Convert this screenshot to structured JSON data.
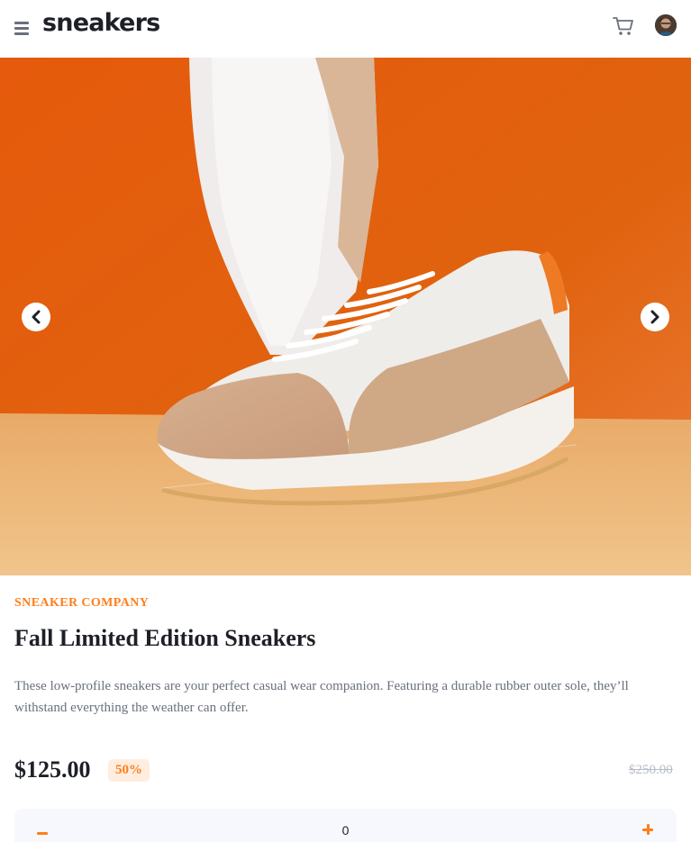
{
  "header": {
    "logo": "sneakers",
    "menu_icon": "hamburger-menu-icon",
    "cart_icon": "cart-icon",
    "avatar": "user-avatar"
  },
  "gallery": {
    "prev_icon": "chevron-left-icon",
    "next_icon": "chevron-right-icon",
    "colors": {
      "background": "#e0630f",
      "floor": "#ecb878"
    }
  },
  "product": {
    "company": "SNEAKER COMPANY",
    "title": "Fall Limited Edition Sneakers",
    "description": "These low-profile sneakers are your perfect casual wear companion. Featuring a durable rubber outer sole, they’ll withstand everything the weather can offer.",
    "price": "$125.00",
    "discount": "50%",
    "original_price": "$250.00"
  },
  "quantity": {
    "value": "0",
    "minus_icon": "minus-icon",
    "plus_icon": "plus-icon"
  },
  "colors": {
    "accent": "#ff7e1b",
    "accent_pale": "#ffede0",
    "text_dark": "#1d2026",
    "text_gray": "#69707d",
    "text_light": "#b6bcc8"
  }
}
